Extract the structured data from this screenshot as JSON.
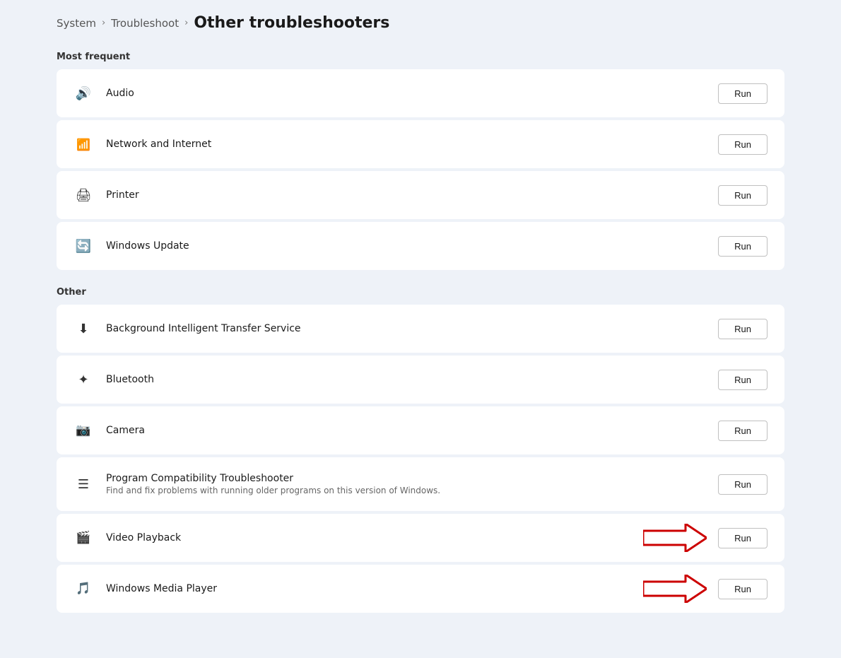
{
  "breadcrumb": {
    "items": [
      {
        "label": "System",
        "id": "system"
      },
      {
        "label": "Troubleshoot",
        "id": "troubleshoot"
      }
    ],
    "current": "Other troubleshooters"
  },
  "sections": [
    {
      "id": "most-frequent",
      "label": "Most frequent",
      "items": [
        {
          "id": "audio",
          "icon": "audio-icon",
          "label": "Audio",
          "sublabel": "",
          "run_label": "Run"
        },
        {
          "id": "network",
          "icon": "network-icon",
          "label": "Network and Internet",
          "sublabel": "",
          "run_label": "Run"
        },
        {
          "id": "printer",
          "icon": "printer-icon",
          "label": "Printer",
          "sublabel": "",
          "run_label": "Run"
        },
        {
          "id": "windows-update",
          "icon": "update-icon",
          "label": "Windows Update",
          "sublabel": "",
          "run_label": "Run"
        }
      ]
    },
    {
      "id": "other",
      "label": "Other",
      "items": [
        {
          "id": "bits",
          "icon": "bits-icon",
          "label": "Background Intelligent Transfer Service",
          "sublabel": "",
          "run_label": "Run",
          "arrow": false
        },
        {
          "id": "bluetooth",
          "icon": "bluetooth-icon",
          "label": "Bluetooth",
          "sublabel": "",
          "run_label": "Run",
          "arrow": false
        },
        {
          "id": "camera",
          "icon": "camera-icon",
          "label": "Camera",
          "sublabel": "",
          "run_label": "Run",
          "arrow": false
        },
        {
          "id": "program-compat",
          "icon": "compat-icon",
          "label": "Program Compatibility Troubleshooter",
          "sublabel": "Find and fix problems with running older programs on this version of Windows.",
          "run_label": "Run",
          "arrow": false
        },
        {
          "id": "video-playback",
          "icon": "video-icon",
          "label": "Video Playback",
          "sublabel": "",
          "run_label": "Run",
          "arrow": true
        },
        {
          "id": "windows-media",
          "icon": "media-icon",
          "label": "Windows Media Player",
          "sublabel": "",
          "run_label": "Run",
          "arrow": true
        }
      ]
    }
  ]
}
